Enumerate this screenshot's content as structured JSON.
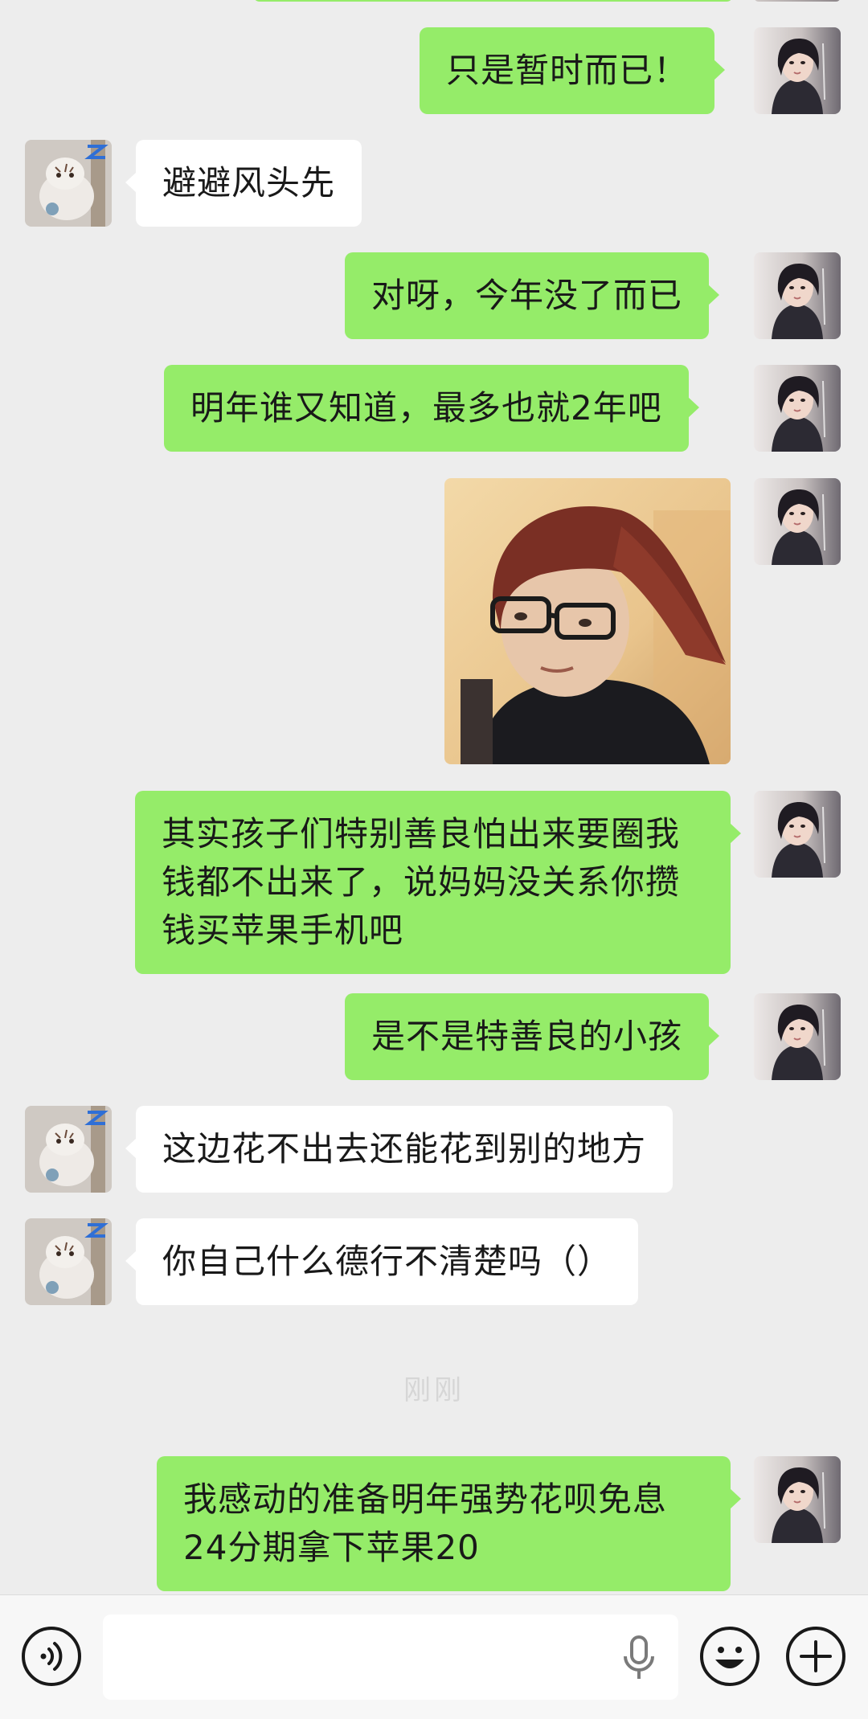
{
  "chat": {
    "faded_text": "刚刚",
    "messages": [
      {
        "sender": "me",
        "text": "只是暂时而已！"
      },
      {
        "sender": "friend",
        "text": "避避风头先"
      },
      {
        "sender": "me",
        "text": "对呀，今年没了而已"
      },
      {
        "sender": "me",
        "text": "明年谁又知道，最多也就2年吧"
      },
      {
        "sender": "me",
        "type": "sticker",
        "image": "person-with-angled-bob-haircut-sticker"
      },
      {
        "sender": "me",
        "lines": [
          "其实孩子们特别善良怕出来要圈我",
          "钱都不出来了，说妈妈没关系你攒",
          "钱买苹果手机吧"
        ]
      },
      {
        "sender": "me",
        "text": "是不是特善良的小孩"
      },
      {
        "sender": "friend",
        "text": "这边花不出去还能花到别的地方"
      },
      {
        "sender": "friend",
        "text": "你自己什么德行不清楚吗（）"
      },
      {
        "sender": "me",
        "lines": [
          "我感动的准备明年强势花呗免息",
          "24分期拿下苹果20"
        ]
      }
    ]
  },
  "input_bar": {
    "placeholder": "",
    "voice_icon": "voice-mode-icon",
    "mic_icon": "microphone-icon",
    "emoji_icon": "emoji-icon",
    "plus_icon": "plus-icon"
  },
  "colors": {
    "background": "#ededed",
    "my_bubble": "#95ec69",
    "friend_bubble": "#ffffff",
    "text": "#191919",
    "input_bar": "#f7f7f7"
  }
}
